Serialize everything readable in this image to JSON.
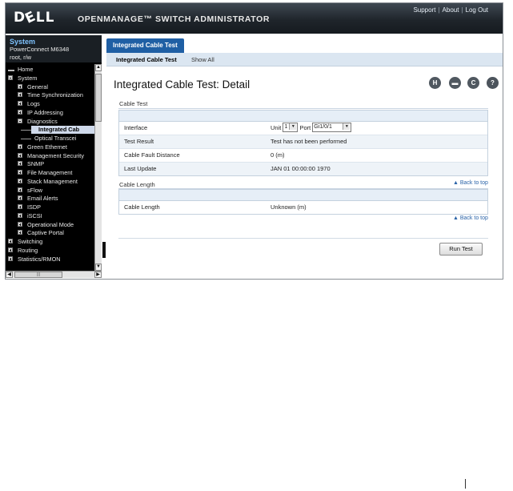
{
  "banner": {
    "logo_text_1": "D",
    "logo_text_e": "E",
    "logo_text_2": "LL",
    "app_title": "OPENMANAGE™ SWITCH ADMINISTRATOR",
    "links": [
      "Support",
      "About",
      "Log Out"
    ]
  },
  "system": {
    "title": "System",
    "model": "PowerConnect M6348",
    "user": "root, r/w"
  },
  "tree": [
    {
      "label": "Home",
      "indent": 0,
      "type": "page"
    },
    {
      "label": "System",
      "indent": 0,
      "type": "minus"
    },
    {
      "label": "General",
      "indent": 1,
      "type": "plus"
    },
    {
      "label": "Time Synchronization",
      "indent": 1,
      "type": "plus"
    },
    {
      "label": "Logs",
      "indent": 1,
      "type": "plus"
    },
    {
      "label": "IP Addressing",
      "indent": 1,
      "type": "plus"
    },
    {
      "label": "Diagnostics",
      "indent": 1,
      "type": "minus"
    },
    {
      "label": "Integrated Cab",
      "indent": 2,
      "type": "leaf",
      "selected": true
    },
    {
      "label": "Optical Transcei",
      "indent": 2,
      "type": "leaf"
    },
    {
      "label": "Green Ethernet",
      "indent": 1,
      "type": "plus"
    },
    {
      "label": "Management Security",
      "indent": 1,
      "type": "plus"
    },
    {
      "label": "SNMP",
      "indent": 1,
      "type": "plus"
    },
    {
      "label": "File Management",
      "indent": 1,
      "type": "plus"
    },
    {
      "label": "Stack Management",
      "indent": 1,
      "type": "plus"
    },
    {
      "label": "sFlow",
      "indent": 1,
      "type": "plus"
    },
    {
      "label": "Email Alerts",
      "indent": 1,
      "type": "plus"
    },
    {
      "label": "ISDP",
      "indent": 1,
      "type": "plus"
    },
    {
      "label": "iSCSI",
      "indent": 1,
      "type": "plus"
    },
    {
      "label": "Operational Mode",
      "indent": 1,
      "type": "plus"
    },
    {
      "label": "Captive Portal",
      "indent": 1,
      "type": "plus"
    },
    {
      "label": "Switching",
      "indent": 0,
      "type": "plus"
    },
    {
      "label": "Routing",
      "indent": 0,
      "type": "plus"
    },
    {
      "label": "Statistics/RMON",
      "indent": 0,
      "type": "plus"
    }
  ],
  "tabs": {
    "active": "Integrated Cable Test",
    "subtabs": [
      "Integrated Cable Test",
      "Show All"
    ]
  },
  "page": {
    "title": "Integrated Cable Test: Detail",
    "toolbar_icons": [
      "save-icon",
      "print-icon",
      "refresh-icon",
      "help-icon"
    ],
    "toolbar_glyphs": {
      "save": "H",
      "print": "▬",
      "refresh": "C",
      "help": "?"
    }
  },
  "cable_test": {
    "section_label": "Cable Test",
    "interface_label": "Interface",
    "unit_label": "Unit",
    "unit_value": "1",
    "port_label": "Port",
    "port_value": "Gi1/0/1",
    "test_result_label": "Test Result",
    "test_result_value": "Test has not been performed",
    "fault_distance_label": "Cable Fault Distance",
    "fault_distance_value": "0  (m)",
    "last_update_label": "Last Update",
    "last_update_value": "JAN 01 00:00:00 1970"
  },
  "cable_length": {
    "section_label": "Cable Length",
    "length_label": "Cable Length",
    "length_value": "Unknown  (m)"
  },
  "back_to_top": "▲ Back to top",
  "run_test_label": "Run Test",
  "colors": {
    "tab_active": "#1f5fa4",
    "subtab_bar": "#dbe6f1",
    "link": "#2a63a8",
    "sidebar_bg": "#000000",
    "system_title": "#7fc3ff"
  }
}
